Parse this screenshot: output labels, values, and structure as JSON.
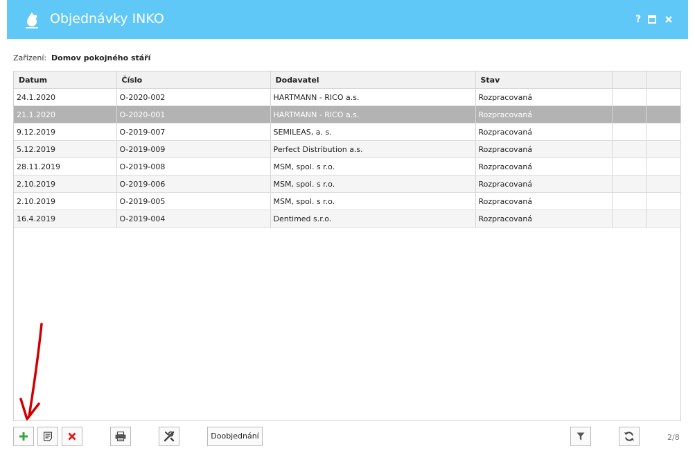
{
  "window": {
    "title": "Objednávky INKO",
    "help_label": "?",
    "maximize_label": "▣",
    "close_label": "✕"
  },
  "facility": {
    "label": "Zařízení:",
    "value": "Domov pokojného stáří"
  },
  "table": {
    "columns": [
      "Datum",
      "Číslo",
      "Dodavatel",
      "Stav",
      "",
      ""
    ],
    "rows": [
      {
        "datum": "24.1.2020",
        "cislo": "O-2020-002",
        "dodavatel": "HARTMANN - RICO a.s.",
        "stav": "Rozpracovaná"
      },
      {
        "datum": "21.1.2020",
        "cislo": "O-2020-001",
        "dodavatel": "HARTMANN - RICO a.s.",
        "stav": "Rozpracovaná"
      },
      {
        "datum": "9.12.2019",
        "cislo": "O-2019-007",
        "dodavatel": "SEMILEAS, a. s.",
        "stav": "Rozpracovaná"
      },
      {
        "datum": "5.12.2019",
        "cislo": "O-2019-009",
        "dodavatel": "Perfect Distribution a.s.",
        "stav": "Rozpracovaná"
      },
      {
        "datum": "28.11.2019",
        "cislo": "O-2019-008",
        "dodavatel": "MSM, spol. s r.o.",
        "stav": "Rozpracovaná"
      },
      {
        "datum": "2.10.2019",
        "cislo": "O-2019-006",
        "dodavatel": "MSM, spol. s r.o.",
        "stav": "Rozpracovaná"
      },
      {
        "datum": "2.10.2019",
        "cislo": "O-2019-005",
        "dodavatel": "MSM, spol. s r.o.",
        "stav": "Rozpracovaná"
      },
      {
        "datum": "16.4.2019",
        "cislo": "O-2019-004",
        "dodavatel": "Dentimed s.r.o.",
        "stav": "Rozpracovaná"
      }
    ],
    "selected_row": 1
  },
  "toolbar": {
    "add_icon": "plus-icon",
    "edit_icon": "document-icon",
    "delete_icon": "close-icon",
    "print_icon": "printer-icon",
    "tools_icon": "tools-icon",
    "reorder_label": "Doobjednání",
    "filter_icon": "filter-icon",
    "refresh_icon": "refresh-icon",
    "page_info": "2/8"
  },
  "colors": {
    "titlebar": "#5fc8f6",
    "selected_row": "#b3b3b3",
    "add_green": "#3aa53a",
    "delete_red": "#e01b1b",
    "annotation_arrow": "#d10000"
  }
}
